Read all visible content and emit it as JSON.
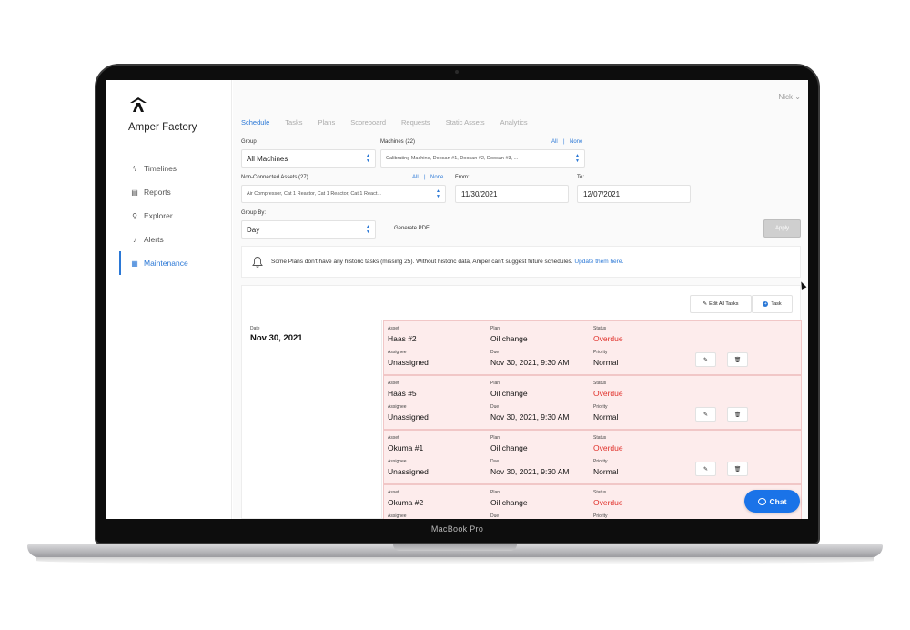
{
  "device": {
    "label": "MacBook Pro"
  },
  "sidebar": {
    "factory_name": "Amper Factory",
    "items": [
      {
        "label": "Timelines",
        "icon": "bolt-icon"
      },
      {
        "label": "Reports",
        "icon": "document-icon"
      },
      {
        "label": "Explorer",
        "icon": "search-icon"
      },
      {
        "label": "Alerts",
        "icon": "bell-icon"
      },
      {
        "label": "Maintenance",
        "icon": "calendar-icon",
        "active": true
      }
    ]
  },
  "header": {
    "user": "Nick",
    "user_chevron": "⌄"
  },
  "tabs": [
    "Schedule",
    "Tasks",
    "Plans",
    "Scoreboard",
    "Requests",
    "Static Assets",
    "Analytics"
  ],
  "filters": {
    "group": {
      "label": "Group",
      "value": "All Machines"
    },
    "machines": {
      "label": "Machines (22)",
      "all": "All",
      "separator": "|",
      "none": "None",
      "value": "Calibrating Machine, Doosan #1, Doosan #2, Doosan #3, ..."
    },
    "non_connected": {
      "label": "Non-Connected Assets (27)",
      "all": "All",
      "separator": "|",
      "none": "None",
      "value": "Air Compressor, Cat 1 Reactor, Cat 1 Reactor, Cat 1 React..."
    },
    "from": {
      "label": "From:",
      "value": "11/30/2021"
    },
    "to": {
      "label": "To:",
      "value": "12/07/2021"
    },
    "group_by": {
      "label": "Group By:",
      "value": "Day"
    },
    "generate_pdf": "Generate PDF",
    "apply": "Apply"
  },
  "notice": {
    "text": "Some Plans don't have any historic tasks (missing 25). Without historic data, Amper can't suggest future schedules. ",
    "link": "Update them here."
  },
  "panel": {
    "edit_all": "Edit All Tasks",
    "add_task": "Task",
    "date_label": "Date",
    "date_value": "Nov 30, 2021"
  },
  "task_labels": {
    "asset": "Asset",
    "plan": "Plan",
    "status": "Status",
    "assignee": "Assignee",
    "due": "Due",
    "priority": "Priority"
  },
  "tasks": [
    {
      "asset": "Haas #2",
      "plan": "Oil change",
      "status": "Overdue",
      "assignee": "Unassigned",
      "due": "Nov 30, 2021, 9:30 AM",
      "priority": "Normal"
    },
    {
      "asset": "Haas #5",
      "plan": "Oil change",
      "status": "Overdue",
      "assignee": "Unassigned",
      "due": "Nov 30, 2021, 9:30 AM",
      "priority": "Normal"
    },
    {
      "asset": "Okuma #1",
      "plan": "Oil change",
      "status": "Overdue",
      "assignee": "Unassigned",
      "due": "Nov 30, 2021, 9:30 AM",
      "priority": "Normal"
    },
    {
      "asset": "Okuma #2",
      "plan": "Oil change",
      "status": "Overdue",
      "assignee": "",
      "due": "",
      "priority": ""
    }
  ],
  "chat": {
    "label": "Chat"
  },
  "colors": {
    "accent": "#2b78d6",
    "overdue": "#e0302a",
    "task_bg": "#fdecec",
    "chat": "#1a73e8"
  }
}
